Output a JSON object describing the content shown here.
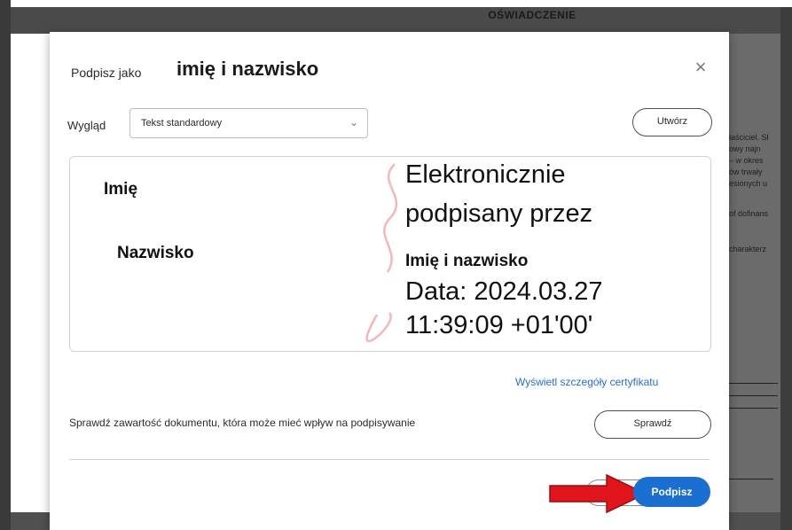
{
  "background": {
    "document_heading": "OŚWIADCZENIE",
    "snippets": [
      "łaściciel. Sł",
      "owy najn",
      "– w okres",
      "ów trwały",
      "esionych u",
      "of dofinans",
      "charakterz"
    ]
  },
  "dialog": {
    "sign_as_label": "Podpisz jako",
    "signer_name": "imię i nazwisko",
    "close_glyph": "×",
    "appearance_label": "Wygląd",
    "appearance_value": "Tekst standardowy",
    "chevron_glyph": "⌄",
    "create_button": "Utwórz",
    "preview": {
      "first_name": "Imię",
      "last_name": "Nazwisko",
      "signed_line1": "Elektronicznie",
      "signed_line2": "podpisany przez",
      "signed_name": "Imię i nazwisko",
      "date_line1": "Data: 2024.03.27",
      "date_line2": "11:39:09 +01'00'"
    },
    "cert_link": "Wyświetl szczegóły certyfikatu",
    "check_text": "Sprawdź zawartość dokumentu, która może mieć wpływ na podpisywanie",
    "check_button": "Sprawdź",
    "sign_button": "Podpisz"
  },
  "colors": {
    "accent": "#1a6fd1",
    "link": "#2b6dc6",
    "arrow": "#e0141b",
    "watermark": "#f2b8b8"
  }
}
